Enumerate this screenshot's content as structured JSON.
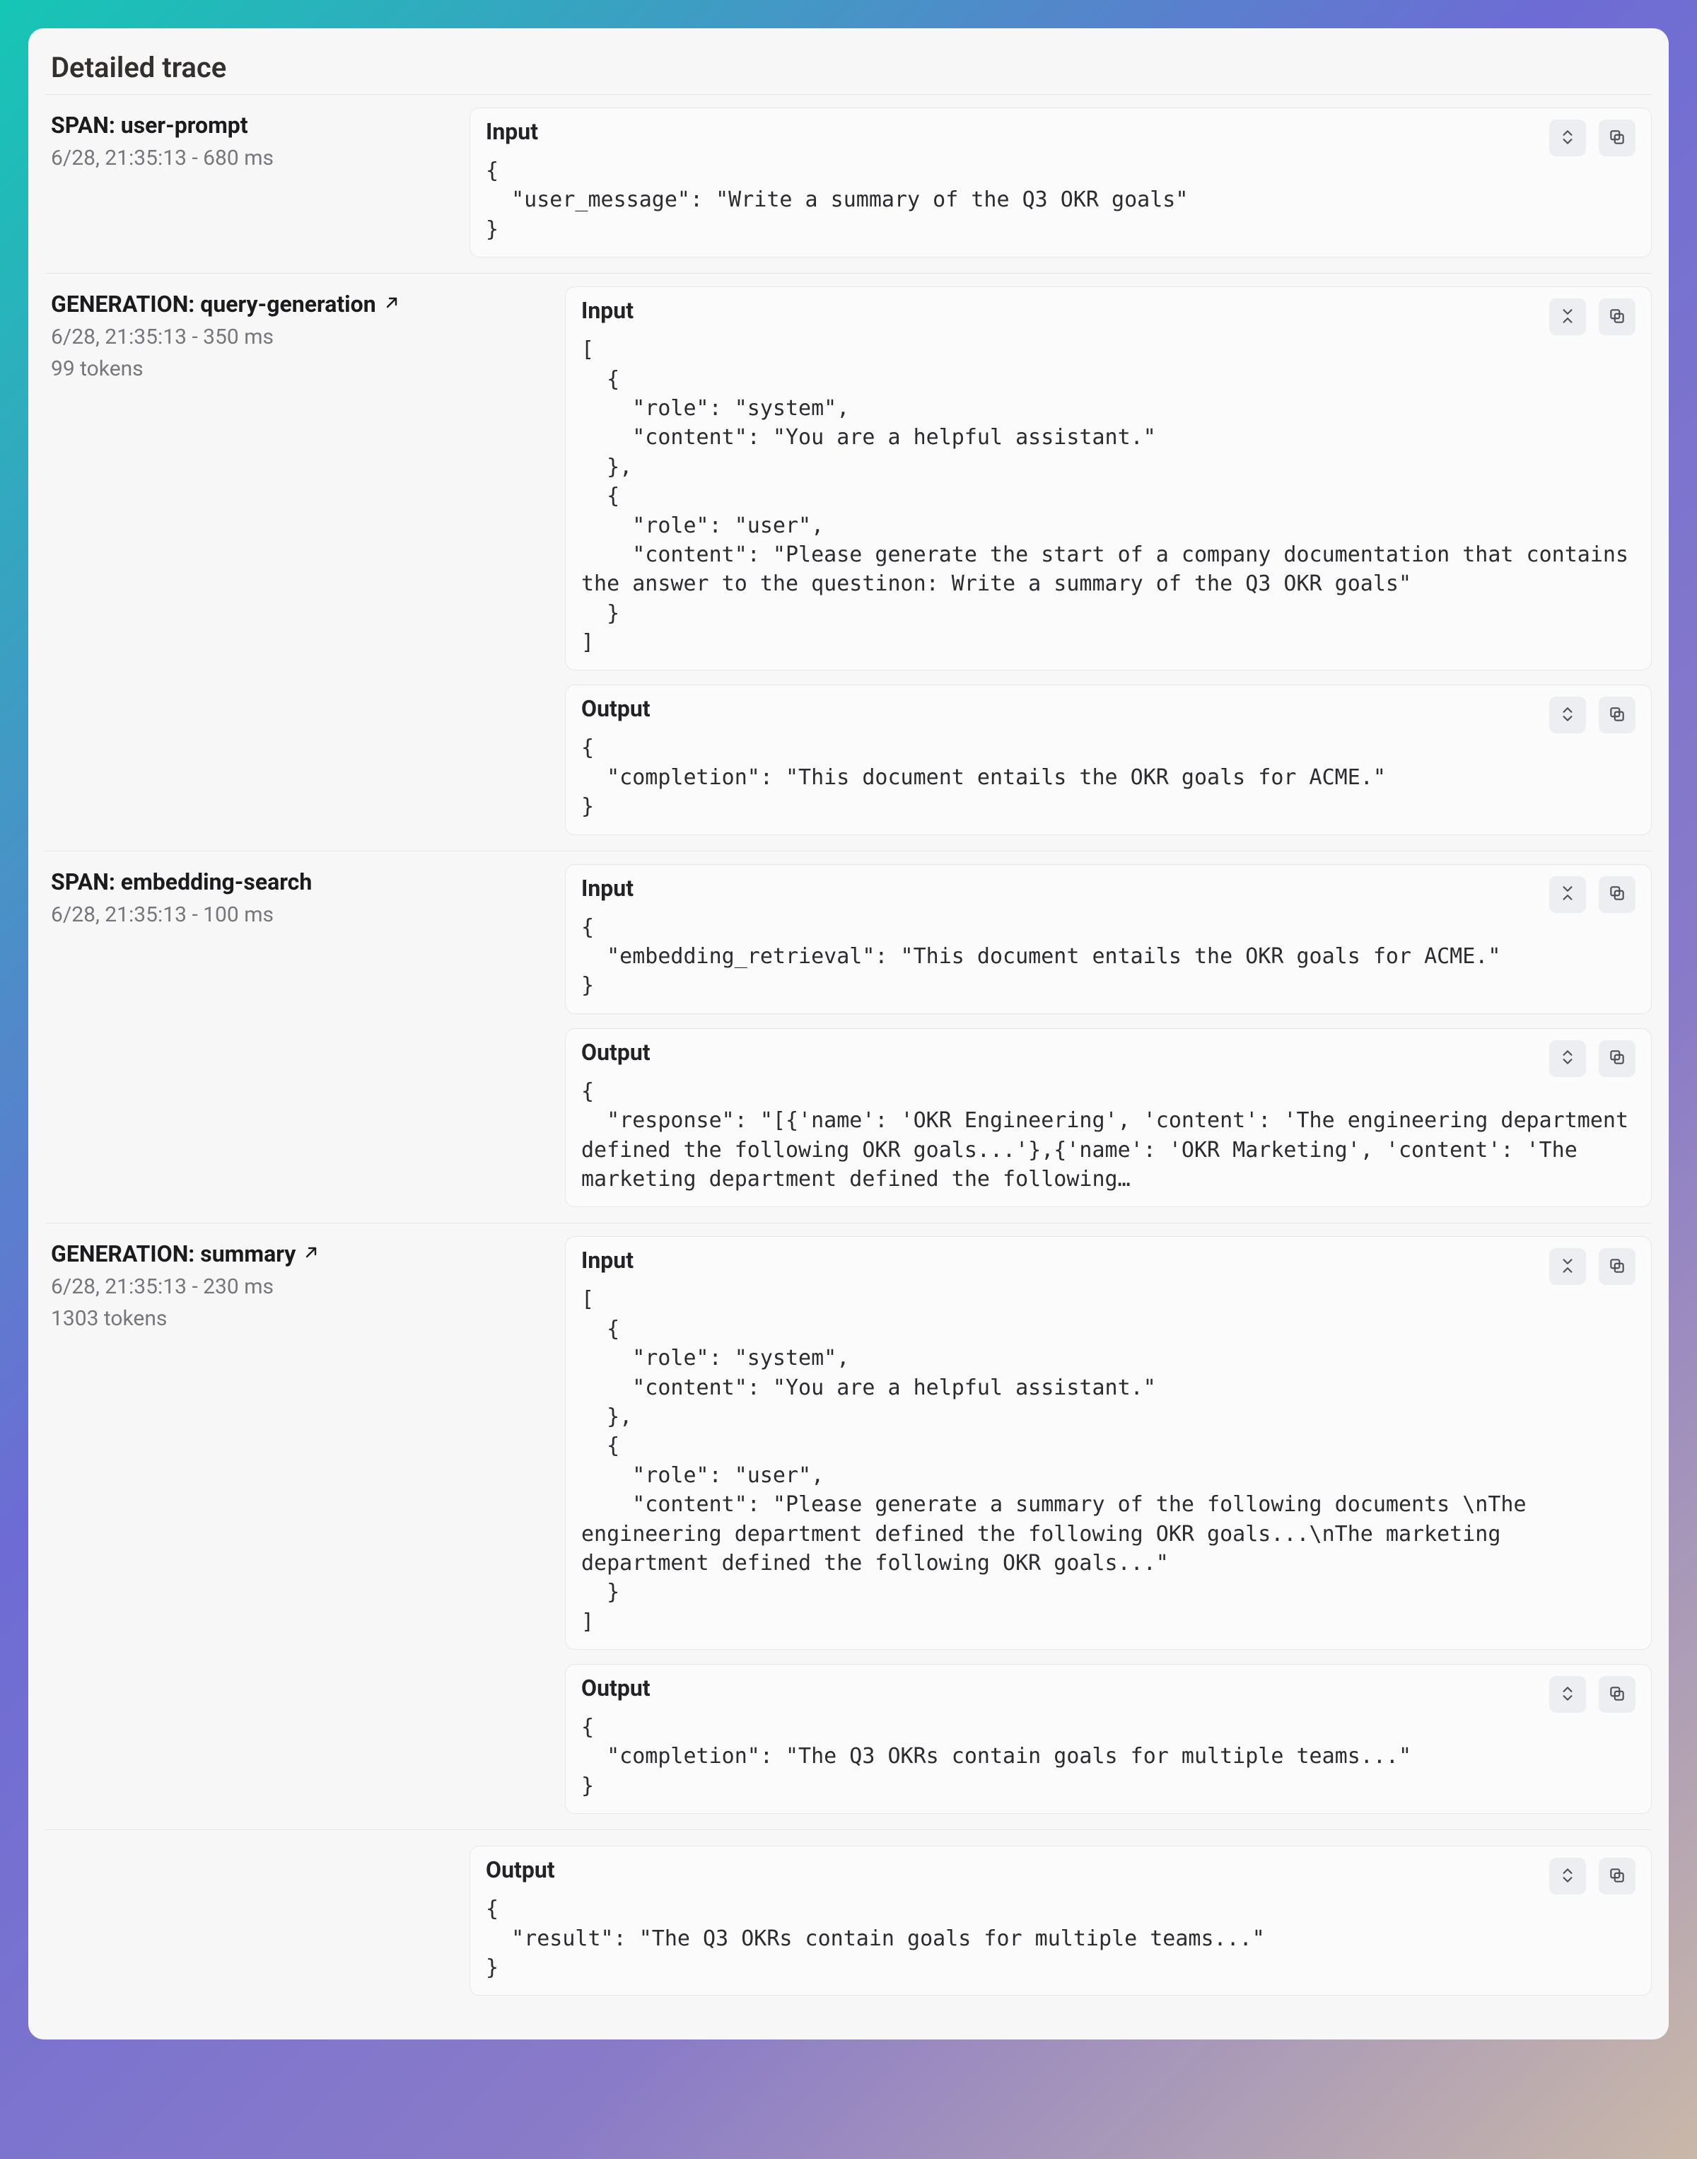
{
  "title": "Detailed trace",
  "sections": [
    {
      "heading": "SPAN: user-prompt",
      "link": false,
      "timestamp": "6/28, 21:35:13 - 680 ms",
      "tokens": "",
      "indent": false,
      "blocks": [
        {
          "label": "Input",
          "toggle": "expand",
          "code": "{\n  \"user_message\": \"Write a summary of the Q3 OKR goals\"\n}"
        }
      ]
    },
    {
      "heading": "GENERATION: query-generation",
      "link": true,
      "timestamp": "6/28, 21:35:13 - 350 ms",
      "tokens": "99 tokens",
      "indent": true,
      "blocks": [
        {
          "label": "Input",
          "toggle": "collapse",
          "code": "[\n  {\n    \"role\": \"system\",\n    \"content\": \"You are a helpful assistant.\"\n  },\n  {\n    \"role\": \"user\",\n    \"content\": \"Please generate the start of a company documentation that contains the answer to the questinon: Write a summary of the Q3 OKR goals\"\n  }\n]"
        },
        {
          "label": "Output",
          "toggle": "expand",
          "code": "{\n  \"completion\": \"This document entails the OKR goals for ACME.\"\n}"
        }
      ]
    },
    {
      "heading": "SPAN: embedding-search",
      "link": false,
      "timestamp": "6/28, 21:35:13 - 100 ms",
      "tokens": "",
      "indent": true,
      "blocks": [
        {
          "label": "Input",
          "toggle": "collapse",
          "code": "{\n  \"embedding_retrieval\": \"This document entails the OKR goals for ACME.\"\n}"
        },
        {
          "label": "Output",
          "toggle": "expand",
          "code": "{\n  \"response\": \"[{'name': 'OKR Engineering', 'content': 'The engineering department defined the following OKR goals...'},{'name': 'OKR Marketing', 'content': 'The marketing department defined the following…"
        }
      ]
    },
    {
      "heading": "GENERATION: summary",
      "link": true,
      "timestamp": "6/28, 21:35:13 - 230 ms",
      "tokens": "1303 tokens",
      "indent": true,
      "blocks": [
        {
          "label": "Input",
          "toggle": "collapse",
          "code": "[\n  {\n    \"role\": \"system\",\n    \"content\": \"You are a helpful assistant.\"\n  },\n  {\n    \"role\": \"user\",\n    \"content\": \"Please generate a summary of the following documents \\nThe engineering department defined the following OKR goals...\\nThe marketing department defined the following OKR goals...\"\n  }\n]"
        },
        {
          "label": "Output",
          "toggle": "expand",
          "code": "{\n  \"completion\": \"The Q3 OKRs contain goals for multiple teams...\"\n}"
        }
      ]
    }
  ],
  "final_output": {
    "label": "Output",
    "toggle": "expand",
    "code": "{\n  \"result\": \"The Q3 OKRs contain goals for multiple teams...\"\n}"
  }
}
